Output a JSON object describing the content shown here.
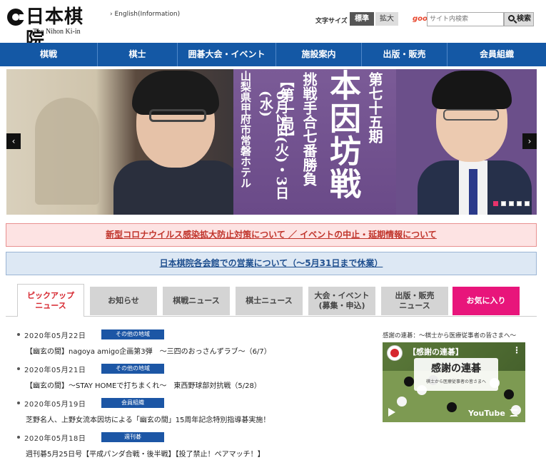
{
  "header": {
    "logo_text": "日本棋院",
    "logo_sub": "The Nihon Ki-in",
    "english_link": "English(Information)",
    "font_size_label": "文字サイズ",
    "size_standard": "標準",
    "size_large": "拡大",
    "goo": "goo",
    "search_placeholder": "サイト内検索",
    "search_button": "検索"
  },
  "nav": {
    "items": [
      "棋戦",
      "棋士",
      "囲碁大会・イベント",
      "施設案内",
      "出版・販売",
      "会員組織"
    ]
  },
  "hero": {
    "term": "第七十五期",
    "title": "本因坊戦",
    "match": "挑戦手合七番勝負",
    "round": "【第一局】",
    "date": "6月2日(火)・3日(水)",
    "venue": "山梨県甲府市常磐ホテル",
    "prev": "‹",
    "next": "›"
  },
  "notices": {
    "covid": "新型コロナウイルス感染拡大防止対策について ／ イベントの中止・延期情報について",
    "hours": "日本棋院各会館での営業について（～5月31日まで休業）"
  },
  "tabs": [
    {
      "line1": "ピックアップ",
      "line2": "ニュース"
    },
    {
      "line1": "お知らせ",
      "line2": ""
    },
    {
      "line1": "棋戦ニュース",
      "line2": ""
    },
    {
      "line1": "棋士ニュース",
      "line2": ""
    },
    {
      "line1": "大会・イベント",
      "line2": "(募集・申込)"
    },
    {
      "line1": "出版・販売",
      "line2": "ニュース"
    },
    {
      "line1": "お気に入り",
      "line2": ""
    }
  ],
  "news": [
    {
      "date": "2020年05月22日",
      "badge": "その他の地域",
      "title": "【幽玄の間】nagoya amigo企画第3弾　～三四のおっさんずラブ～（6/7）"
    },
    {
      "date": "2020年05月21日",
      "badge": "その他の地域",
      "title": "【幽玄の間】～STAY HOMEで打ちまくれ～　東西野球部対抗戦（5/28）"
    },
    {
      "date": "2020年05月19日",
      "badge": "会員組織",
      "title": "芝野名人、上野女流本因坊による「幽玄の間」15周年記念特別指導碁実施！"
    },
    {
      "date": "2020年05月18日",
      "badge": "週刊碁",
      "title": "週刊碁5月25日号【平成パンダ合戦・後半戦】【投了禁止！ペアマッチ！】"
    }
  ],
  "video": {
    "label": "感謝の連碁：～棋士から医療従事者の皆さまへ～",
    "title": "【感謝の連碁】",
    "card_title": "感謝の連碁",
    "card_sub": "棋士から医療従事者の皆さまへ",
    "menu": "⋮",
    "youtube": "YouTube"
  }
}
